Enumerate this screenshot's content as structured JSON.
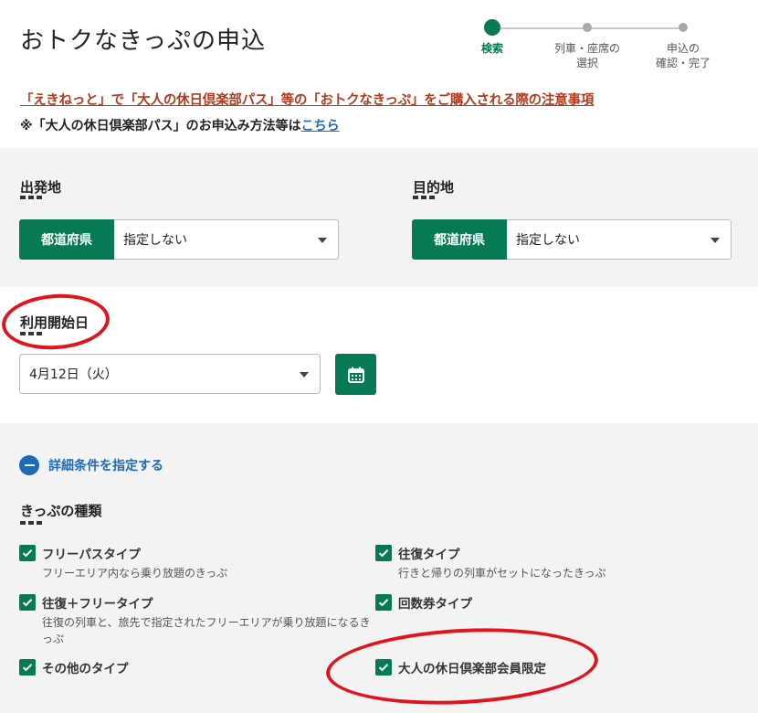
{
  "page_title": "おトクなきっぷの申込",
  "steps": [
    {
      "label": "検索",
      "active": true
    },
    {
      "label": "列車・座席の\n選択",
      "active": false
    },
    {
      "label": "申込の\n確認・完了",
      "active": false
    }
  ],
  "notice_link": "「えきねっと」で「大人の休日倶楽部パス」等の「おトクなきっぷ」をご購入される際の注意事項",
  "note": {
    "prefix": "※「大人の休日倶楽部パス」のお申込み方法等は",
    "link": "こちら"
  },
  "departure": {
    "label": "出発地",
    "button": "都道府県",
    "value": "指定しない"
  },
  "destination": {
    "label": "目的地",
    "button": "都道府県",
    "value": "指定しない"
  },
  "start_date": {
    "label": "利用開始日",
    "value": "4月12日（火）"
  },
  "detail_toggle": "詳細条件を指定する",
  "ticket_types": {
    "label": "きっぷの種類",
    "items": [
      {
        "label": "フリーパスタイプ",
        "desc": "フリーエリア内なら乗り放題のきっぷ",
        "checked": true
      },
      {
        "label": "往復タイプ",
        "desc": "行きと帰りの列車がセットになったきっぷ",
        "checked": true
      },
      {
        "label": "往復＋フリータイプ",
        "desc": "往復の列車と、旅先で指定されたフリーエリアが乗り放題になるきっぷ",
        "checked": true
      },
      {
        "label": "回数券タイプ",
        "desc": "",
        "checked": true
      },
      {
        "label": "その他のタイプ",
        "desc": "",
        "checked": true
      },
      {
        "label": "大人の休日倶楽部会員限定",
        "desc": "",
        "checked": true
      }
    ]
  },
  "colors": {
    "accent": "#077a55",
    "link_blue": "#1d6bb8",
    "notice_red": "#b23b1e",
    "annotation_red": "#e0141c"
  }
}
